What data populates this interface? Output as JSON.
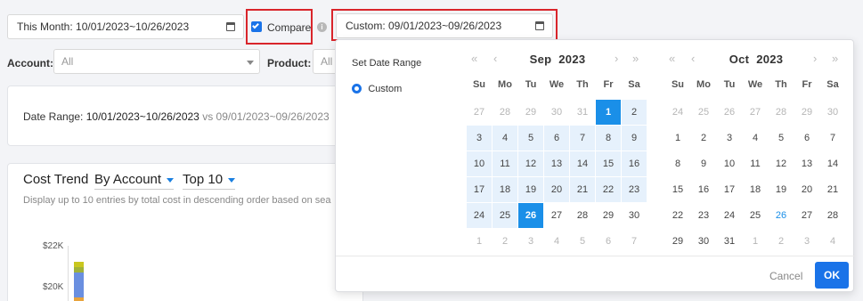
{
  "toolbar": {
    "date_range_label": "This Month: 10/01/2023~10/26/2023",
    "compare_label": "Compare",
    "compare_checked": true,
    "compare_range_label": "Custom: 09/01/2023~09/26/2023"
  },
  "filters": {
    "account_label": "Account:",
    "account_value": "All",
    "product_label": "Product:",
    "product_value": "All"
  },
  "summary": {
    "label": "Date Range:",
    "range": "10/01/2023~10/26/2023",
    "vs": "vs",
    "compare_range": "09/01/2023~09/26/2023"
  },
  "cost_trend": {
    "title": "Cost Trend",
    "group_by": "By Account",
    "top": "Top 10",
    "description": "Display up to 10 entries by total cost in descending order based on sea",
    "y_ticks": [
      "$22K",
      "$20K"
    ]
  },
  "date_picker": {
    "side_title": "Set Date Range",
    "option_custom": "Custom",
    "weekdays": [
      "Su",
      "Mo",
      "Tu",
      "We",
      "Th",
      "Fr",
      "Sa"
    ],
    "nav": {
      "prev_year": "«",
      "prev_month": "‹",
      "next_month": "›",
      "next_year": "»"
    },
    "months": [
      {
        "title_month": "Sep",
        "title_year": "2023",
        "days": [
          [
            "27",
            "28",
            "29",
            "30",
            "31",
            "1",
            "2"
          ],
          [
            "3",
            "4",
            "5",
            "6",
            "7",
            "8",
            "9"
          ],
          [
            "10",
            "11",
            "12",
            "13",
            "14",
            "15",
            "16"
          ],
          [
            "17",
            "18",
            "19",
            "20",
            "21",
            "22",
            "23"
          ],
          [
            "24",
            "25",
            "26",
            "27",
            "28",
            "29",
            "30"
          ],
          [
            "1",
            "2",
            "3",
            "4",
            "5",
            "6",
            "7"
          ]
        ]
      },
      {
        "title_month": "Oct",
        "title_year": "2023",
        "days": [
          [
            "24",
            "25",
            "26",
            "27",
            "28",
            "29",
            "30"
          ],
          [
            "1",
            "2",
            "3",
            "4",
            "5",
            "6",
            "7"
          ],
          [
            "8",
            "9",
            "10",
            "11",
            "12",
            "13",
            "14"
          ],
          [
            "15",
            "16",
            "17",
            "18",
            "19",
            "20",
            "21"
          ],
          [
            "22",
            "23",
            "24",
            "25",
            "26",
            "27",
            "28"
          ],
          [
            "29",
            "30",
            "31",
            "1",
            "2",
            "3",
            "4"
          ]
        ]
      }
    ],
    "cancel_label": "Cancel",
    "ok_label": "OK",
    "colors": {
      "accent": "#1a8fe8",
      "range_bg": "#e6f1fc",
      "highlight": "#d9252b"
    }
  }
}
